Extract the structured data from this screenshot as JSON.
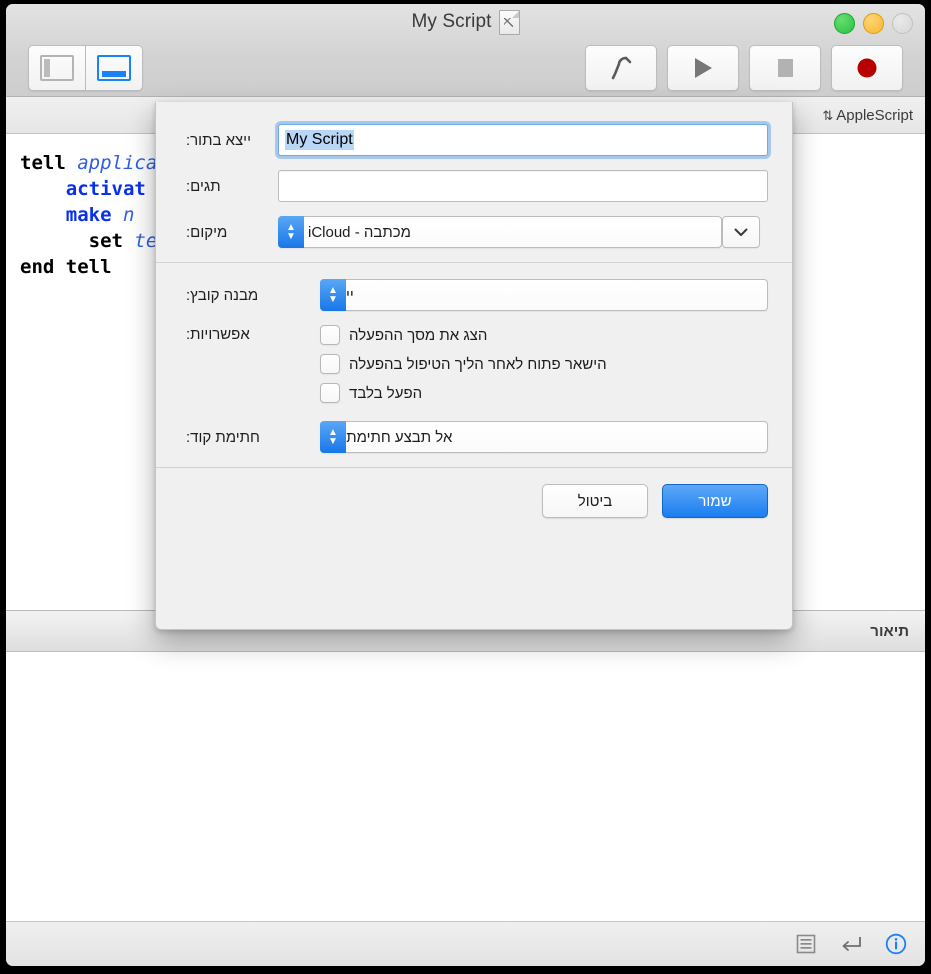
{
  "window": {
    "title": "My Script",
    "doc_icon": "script-document-icon",
    "traffic_lights": [
      {
        "name": "close",
        "color": "#d6d6d6",
        "enabled": false
      },
      {
        "name": "minimize",
        "color": "#f7b731",
        "enabled": true
      },
      {
        "name": "zoom",
        "color": "#27c33e",
        "enabled": true
      }
    ]
  },
  "toolbar": {
    "left_group": [
      {
        "name": "sidebar-toggle",
        "icon": "sidebar-pane-icon",
        "active": false
      },
      {
        "name": "bottom-pane-toggle",
        "icon": "bottom-pane-icon",
        "active": true
      }
    ],
    "right_group": [
      {
        "name": "compile",
        "icon": "hammer-icon"
      },
      {
        "name": "run",
        "icon": "play-icon"
      },
      {
        "name": "stop",
        "icon": "stop-square-icon"
      },
      {
        "name": "record",
        "icon": "record-circle-icon"
      }
    ]
  },
  "language_bar": {
    "popup_value": "AppleScript",
    "chevron": "⇅"
  },
  "editor": {
    "lines": [
      {
        "segments": [
          {
            "text": "tell ",
            "style": "kw"
          },
          {
            "text": "applicati",
            "style": "ita"
          }
        ]
      },
      {
        "segments": [
          {
            "text": "    ",
            "style": "plain"
          },
          {
            "text": "activat",
            "style": "blu"
          }
        ]
      },
      {
        "segments": [
          {
            "text": "    ",
            "style": "plain"
          },
          {
            "text": "make ",
            "style": "blu"
          },
          {
            "text": "n",
            "style": "ita"
          }
        ]
      },
      {
        "segments": [
          {
            "text": "      ",
            "style": "plain"
          },
          {
            "text": "set ",
            "style": "kw"
          },
          {
            "text": "text",
            "style": "ita"
          }
        ]
      },
      {
        "segments": [
          {
            "text": "end tell",
            "style": "kw"
          }
        ]
      }
    ]
  },
  "description_panel": {
    "tab_label": "תיאור",
    "content": ""
  },
  "status_bar": {
    "items": [
      {
        "name": "info",
        "icon": "info-circle-icon",
        "color": "#1a82f7"
      },
      {
        "name": "return",
        "icon": "return-arrow-icon"
      },
      {
        "name": "lines",
        "icon": "list-lines-icon"
      }
    ]
  },
  "save_sheet": {
    "export_as": {
      "label": "ייצא בתור:",
      "value": "My Script",
      "selected": true,
      "focused": true
    },
    "tags": {
      "label": "תגים:",
      "value": "",
      "placeholder": ""
    },
    "location": {
      "label": "מיקום:",
      "value": "מכתבה - iCloud",
      "icon": "icloud-cloud-icon",
      "expand_icon": "chevron-down-icon"
    },
    "file_format": {
      "label": "מבנה קובץ:",
      "value": "יישום"
    },
    "options": {
      "label": "אפשרויות:",
      "items": [
        {
          "label": "הצג את מסך ההפעלה",
          "checked": false
        },
        {
          "label": "הישאר פתוח לאחר הליך הטיפול בהפעלה",
          "checked": false
        },
        {
          "label": "הפעל בלבד",
          "checked": false
        }
      ]
    },
    "code_signing": {
      "label": "חתימת קוד:",
      "value": "אל תבצע חתימת קוד"
    },
    "buttons": {
      "save": "שמור",
      "cancel": "ביטול"
    }
  },
  "colors": {
    "accent_blue": "#1b7ef0",
    "selection_blue": "#b8d6f6",
    "record_red": "#b80000",
    "window_chrome": "#d3d3d3"
  }
}
